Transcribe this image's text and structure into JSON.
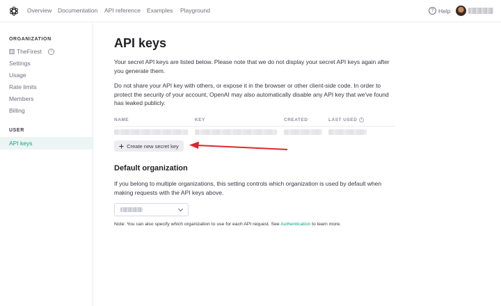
{
  "nav": {
    "links": [
      "Overview",
      "Documentation",
      "API reference",
      "Examples",
      "Playground"
    ],
    "help_label": "Help"
  },
  "sidebar": {
    "org_heading": "ORGANIZATION",
    "org_name": "TheFirest",
    "org_items": [
      "Settings",
      "Usage",
      "Rate limits",
      "Members",
      "Billing"
    ],
    "user_heading": "USER",
    "active_item": "API keys"
  },
  "main": {
    "title": "API keys",
    "intro": "Your secret API keys are listed below. Please note that we do not display your secret API keys again after you generate them.",
    "warning": "Do not share your API key with others, or expose it in the browser or other client-side code. In order to protect the security of your account, OpenAI may also automatically disable any API key that we've found has leaked publicly.",
    "table": {
      "columns": [
        "NAME",
        "KEY",
        "CREATED",
        "LAST USED"
      ]
    },
    "create_button": "Create new secret key",
    "default_org": {
      "title": "Default organization",
      "description": "If you belong to multiple organizations, this setting controls which organization is used by default when making requests with the API keys above.",
      "note_prefix": "Note: You can also specify which organization to use for each API request. See ",
      "note_link": "Authentication",
      "note_suffix": " to learn more."
    }
  },
  "colors": {
    "accent": "#10a37f",
    "annotation_arrow": "#e0262a"
  },
  "icons": [
    "openai-logo-icon",
    "help-icon",
    "building-icon",
    "info-icon",
    "plus-icon",
    "chevron-down-icon"
  ]
}
